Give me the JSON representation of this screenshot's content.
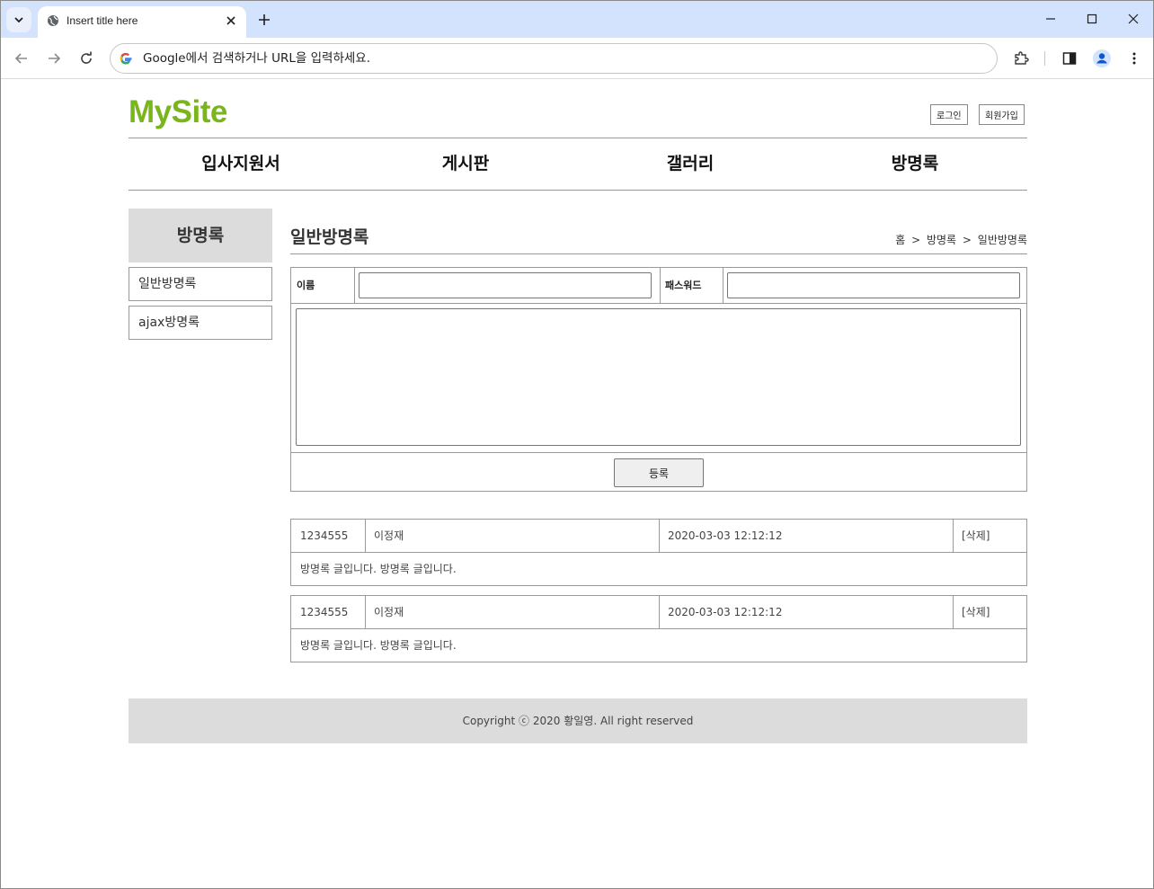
{
  "browser": {
    "tab_title": "Insert title here",
    "omnibox_placeholder": "Google에서 검색하거나 URL을 입력하세요."
  },
  "header": {
    "logo": "MySite",
    "login": "로그인",
    "join": "회원가입"
  },
  "nav": [
    "입사지원서",
    "게시판",
    "갤러리",
    "방명록"
  ],
  "sidebar": {
    "title": "방명록",
    "items": [
      "일반방명록",
      "ajax방명록"
    ]
  },
  "content": {
    "title": "일반방명록",
    "breadcrumb": [
      "홈",
      ">",
      "방명록",
      ">",
      "일반방명록"
    ],
    "form": {
      "name_label": "이름",
      "password_label": "패스워드",
      "submit_label": "등록"
    },
    "entries": [
      {
        "no": "1234555",
        "name": "이정재",
        "date": "2020-03-03 12:12:12",
        "delete": "[삭제]",
        "content": "방명록 글입니다. 방명록 글입니다."
      },
      {
        "no": "1234555",
        "name": "이정재",
        "date": "2020-03-03 12:12:12",
        "delete": "[삭제]",
        "content": "방명록 글입니다. 방명록 글입니다."
      }
    ]
  },
  "footer": {
    "text": "Copyright ⓒ 2020 황일영. All right reserved"
  }
}
